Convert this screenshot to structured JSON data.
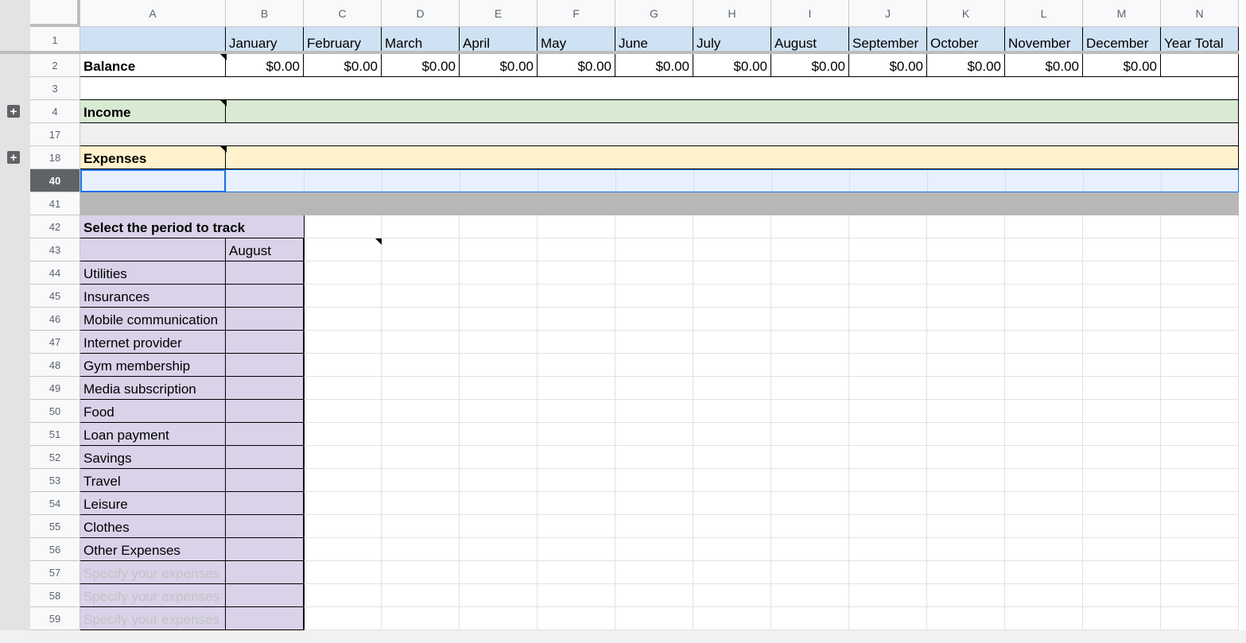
{
  "columns": [
    "A",
    "B",
    "C",
    "D",
    "E",
    "F",
    "G",
    "H",
    "I",
    "J",
    "K",
    "L",
    "M",
    "N"
  ],
  "row_numbers": [
    "1",
    "2",
    "3",
    "4",
    "17",
    "18",
    "40",
    "41",
    "42",
    "43",
    "44",
    "45",
    "46",
    "47",
    "48",
    "49",
    "50",
    "51",
    "52",
    "53",
    "54",
    "55",
    "56",
    "57",
    "58",
    "59"
  ],
  "months_header": [
    "January",
    "February",
    "March",
    "April",
    "May",
    "June",
    "July",
    "August",
    "September",
    "October",
    "November",
    "December",
    "Year Total"
  ],
  "balance": {
    "label": "Balance",
    "values": [
      "$0.00",
      "$0.00",
      "$0.00",
      "$0.00",
      "$0.00",
      "$0.00",
      "$0.00",
      "$0.00",
      "$0.00",
      "$0.00",
      "$0.00",
      "$0.00"
    ]
  },
  "income": {
    "label": "Income"
  },
  "expenses": {
    "label": "Expenses"
  },
  "tracker": {
    "title": "Select the period to track",
    "selected_period": "August",
    "categories": [
      "Utilities",
      "Insurances",
      "Mobile communication",
      "Internet provider",
      "Gym membership",
      "Media subscription",
      "Food",
      "Loan payment",
      "Savings",
      "Travel",
      "Leisure",
      "Clothes",
      "Other Expenses"
    ],
    "placeholders": [
      "Specify your expenses",
      "Specify your expenses",
      "Specify your expenses"
    ]
  },
  "colors": {
    "header_blue": "#cfe2f3",
    "income_green": "#d9ead3",
    "expenses_yellow": "#fff2cc",
    "tracker_purple": "#d9d2e9",
    "selected_row": "#e8f0fe",
    "selection_border": "#1a73e8"
  },
  "icons": [
    "expand-group-icon",
    "note-indicator-icon",
    "dropdown-arrow-icon"
  ]
}
